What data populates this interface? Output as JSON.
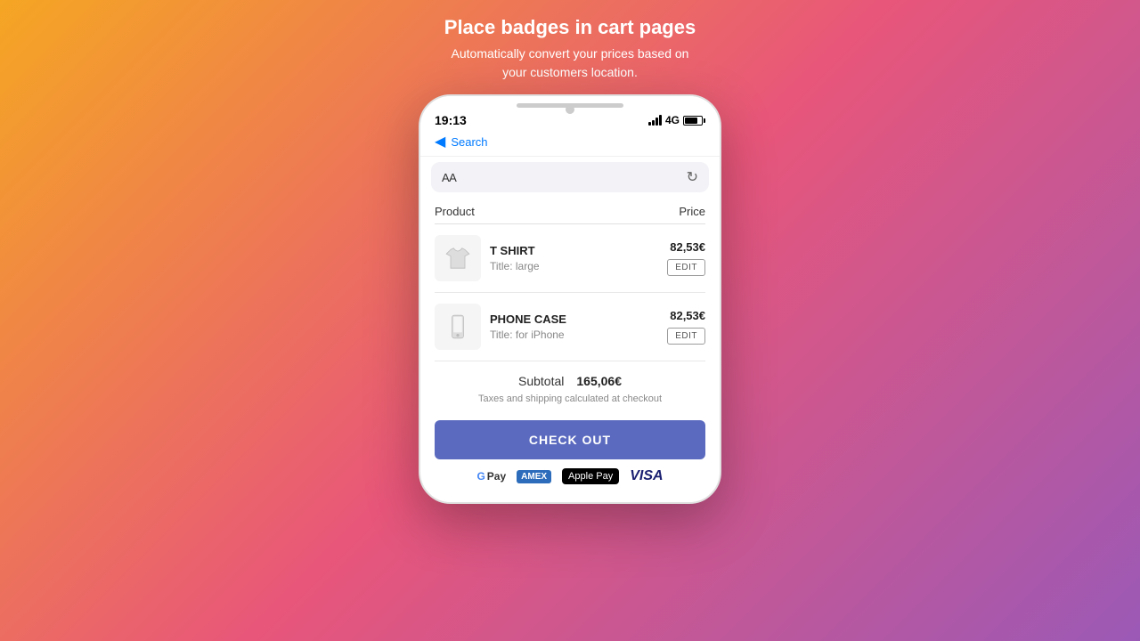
{
  "headline": {
    "title": "Place badges in cart pages",
    "subtitle": "Automatically convert your prices based on\nyour customers location."
  },
  "status_bar": {
    "time": "19:13",
    "network_type": "4G"
  },
  "nav": {
    "back_label": "Search"
  },
  "browser": {
    "text_size_label": "AA"
  },
  "cart": {
    "header_product": "Product",
    "header_price": "Price",
    "items": [
      {
        "name": "T SHIRT",
        "title_label": "Title: large",
        "price": "82,53€",
        "edit_label": "EDIT",
        "type": "tshirt"
      },
      {
        "name": "PHONE CASE",
        "title_label": "Title: for iPhone",
        "price": "82,53€",
        "edit_label": "EDIT",
        "type": "phonecase"
      }
    ],
    "subtotal_label": "Subtotal",
    "subtotal_value": "165,06€",
    "tax_note": "Taxes and shipping calculated at checkout",
    "checkout_label": "CHECK OUT"
  },
  "payment": {
    "google_pay": "Google Pay",
    "amex": "AMEX",
    "apple_pay": "Apple Pay",
    "visa": "VISA"
  }
}
